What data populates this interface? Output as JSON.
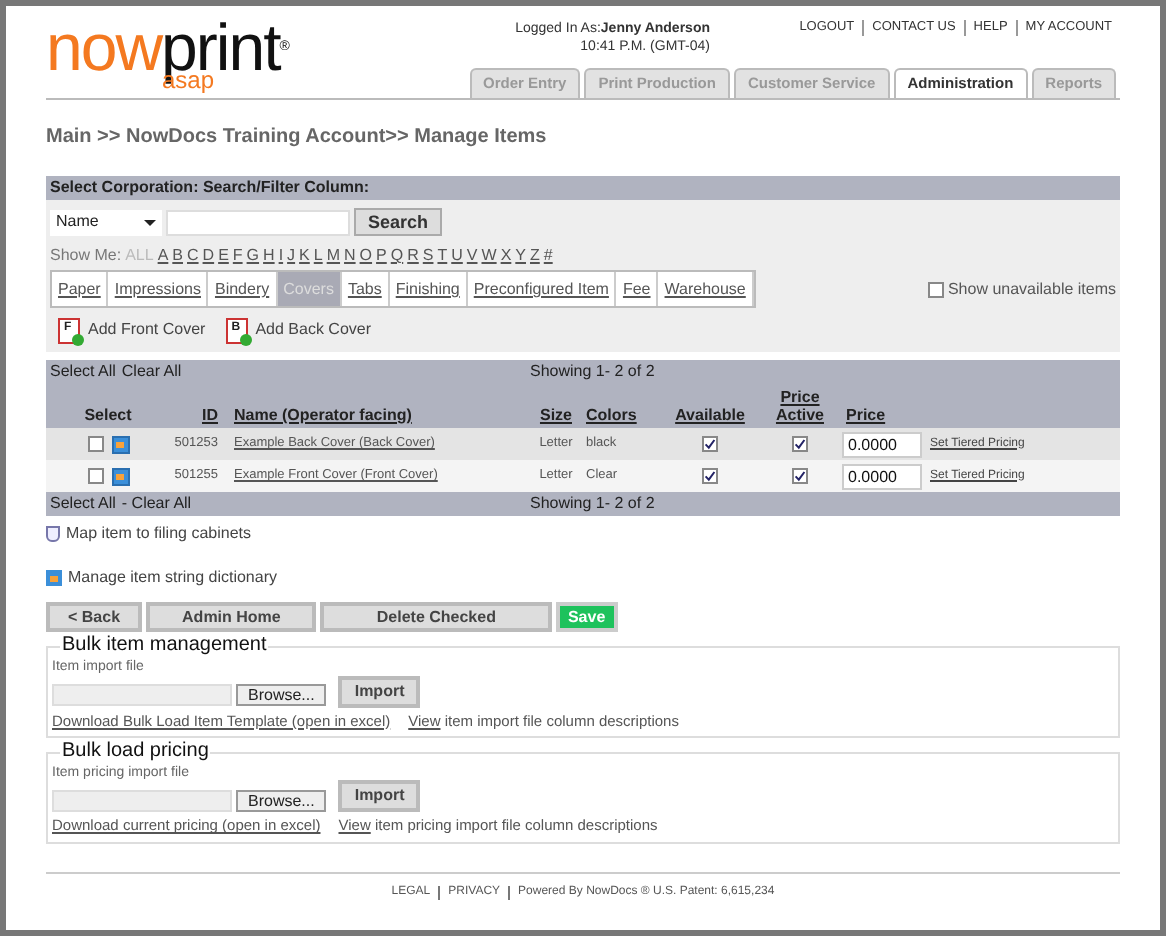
{
  "header": {
    "logo_main": "now",
    "logo_accent": "print",
    "logo_mark": "®",
    "logo_sub": "asap",
    "logged_in_label": "Logged In As:",
    "user": "Jenny Anderson",
    "time": "10:41 P.M. (GMT-04)",
    "links": [
      "LOGOUT",
      "CONTACT US",
      "HELP",
      "MY ACCOUNT"
    ]
  },
  "nav_tabs": [
    {
      "label": "Order Entry",
      "selected": false
    },
    {
      "label": "Print Production",
      "selected": false
    },
    {
      "label": "Customer Service",
      "selected": false
    },
    {
      "label": "Administration",
      "selected": true
    },
    {
      "label": "Reports",
      "selected": false
    }
  ],
  "breadcrumb": "Main >> NowDocs Training Account>> Manage Items",
  "filter": {
    "title": "Select Corporation: Search/Filter Column:",
    "column": "Name",
    "search_button": "Search",
    "show_me_label": "Show Me:",
    "letters": [
      {
        "label": "ALL",
        "selected": true
      },
      {
        "label": "A",
        "selected": false
      },
      {
        "label": "B",
        "selected": false
      },
      {
        "label": "C",
        "selected": false
      },
      {
        "label": "D",
        "selected": false
      },
      {
        "label": "E",
        "selected": false
      },
      {
        "label": "F",
        "selected": false
      },
      {
        "label": "G",
        "selected": false
      },
      {
        "label": "H",
        "selected": false
      },
      {
        "label": "I",
        "selected": false
      },
      {
        "label": "J",
        "selected": false
      },
      {
        "label": "K",
        "selected": false
      },
      {
        "label": "L",
        "selected": false
      },
      {
        "label": "M",
        "selected": false
      },
      {
        "label": "N",
        "selected": false
      },
      {
        "label": "O",
        "selected": false
      },
      {
        "label": "P",
        "selected": false
      },
      {
        "label": "Q",
        "selected": false
      },
      {
        "label": "R",
        "selected": false
      },
      {
        "label": "S",
        "selected": false
      },
      {
        "label": "T",
        "selected": false
      },
      {
        "label": "U",
        "selected": false
      },
      {
        "label": "V",
        "selected": false
      },
      {
        "label": "W",
        "selected": false
      },
      {
        "label": "X",
        "selected": false
      },
      {
        "label": "Y",
        "selected": false
      },
      {
        "label": "Z",
        "selected": false
      },
      {
        "label": "#",
        "selected": false
      }
    ],
    "show_unavailable": {
      "label": "Show unavailable items",
      "checked": false
    }
  },
  "category_tabs": [
    {
      "label": "Paper",
      "selected": false
    },
    {
      "label": "Impressions",
      "selected": false
    },
    {
      "label": "Bindery",
      "selected": false
    },
    {
      "label": "Covers",
      "selected": true
    },
    {
      "label": "Tabs",
      "selected": false
    },
    {
      "label": "Finishing",
      "selected": false
    },
    {
      "label": "Preconfigured Item",
      "selected": false
    },
    {
      "label": "Fee",
      "selected": false
    },
    {
      "label": "Warehouse",
      "selected": false
    }
  ],
  "add_actions": [
    {
      "icon_letter": "F",
      "label": "Add Front Cover"
    },
    {
      "icon_letter": "B",
      "label": "Add Back Cover"
    }
  ],
  "table": {
    "top_bar": {
      "select_all": "Select All",
      "clear_all": "Clear All",
      "showing": "Showing 1- 2 of 2"
    },
    "columns": [
      {
        "label": "Select",
        "sortable": false
      },
      {
        "label": "ID",
        "sortable": true
      },
      {
        "label": "Name (Operator facing)",
        "sortable": true
      },
      {
        "label": "Size",
        "sortable": true
      },
      {
        "label": "Colors",
        "sortable": true
      },
      {
        "label": "Available",
        "sortable": true
      },
      {
        "label": "Price Active",
        "sortable": true
      },
      {
        "label": "Price",
        "sortable": true
      }
    ],
    "rows": [
      {
        "checked": false,
        "id": "501253",
        "name": "Example Back Cover (Back Cover)",
        "size": "Letter",
        "colors": "black",
        "available": true,
        "price_active": true,
        "price": "0.0000",
        "tiered_link": "Set Tiered Pricing"
      },
      {
        "checked": false,
        "id": "501255",
        "name": "Example Front Cover (Front Cover)",
        "size": "Letter",
        "colors": "Clear",
        "available": true,
        "price_active": true,
        "price": "0.0000",
        "tiered_link": "Set Tiered Pricing"
      }
    ],
    "bottom_bar": {
      "select_all": "Select All",
      "clear_all": "- Clear All",
      "showing": "Showing 1- 2 of 2"
    }
  },
  "links": [
    {
      "kind": "cabinet",
      "label": "Map item to filing cabinets"
    },
    {
      "kind": "dictionary",
      "label": "Manage item string dictionary"
    }
  ],
  "buttons": [
    {
      "label": "< Back",
      "kind": "default"
    },
    {
      "label": "Admin Home",
      "kind": "default"
    },
    {
      "label": "Delete Checked",
      "kind": "default"
    },
    {
      "label": "Save",
      "kind": "primary"
    }
  ],
  "sections": [
    {
      "legend": "Bulk item management",
      "file_label": "Item import file",
      "browse": "Browse...",
      "import": "Import",
      "download_link": "Download Bulk Load Item Template (open in excel)",
      "view_link": "View",
      "view_text": "item import file column descriptions"
    },
    {
      "legend": "Bulk load pricing",
      "file_label": "Item pricing import file",
      "browse": "Browse...",
      "import": "Import",
      "download_link": "Download current pricing (open in excel)",
      "view_link": "View",
      "view_text": "item pricing import file column descriptions"
    }
  ],
  "footer": [
    "LEGAL",
    "PRIVACY",
    "Powered By NowDocs ® U.S. Patent: 6,615,234"
  ]
}
